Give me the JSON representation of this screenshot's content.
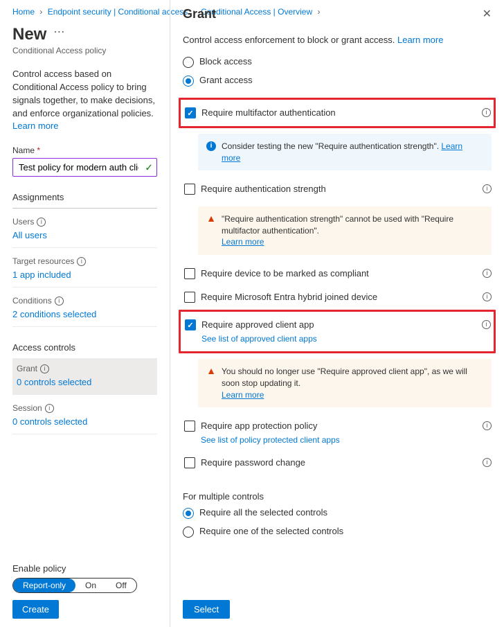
{
  "breadcrumb": [
    {
      "label": "Home"
    },
    {
      "label": "Endpoint security | Conditional access"
    },
    {
      "label": "Conditional Access | Overview"
    }
  ],
  "left": {
    "title": "New",
    "subtitle": "Conditional Access policy",
    "description": "Control access based on Conditional Access policy to bring signals together, to make decisions, and enforce organizational policies.",
    "learn_more": "Learn more",
    "name_label": "Name",
    "name_value": "Test policy for modern auth clients",
    "assignments_h": "Assignments",
    "users_label": "Users",
    "users_value": "All users",
    "target_label": "Target resources",
    "target_value": "1 app included",
    "conditions_label": "Conditions",
    "conditions_value": "2 conditions selected",
    "access_h": "Access controls",
    "grant_label": "Grant",
    "grant_value": "0 controls selected",
    "session_label": "Session",
    "session_value": "0 controls selected",
    "enable_label": "Enable policy",
    "toggle": {
      "report": "Report-only",
      "on": "On",
      "off": "Off"
    },
    "create": "Create"
  },
  "right": {
    "title": "Grant",
    "description_prefix": "Control access enforcement to block or grant access. ",
    "learn_more": "Learn more",
    "block_label": "Block access",
    "grant_label": "Grant access",
    "opts": {
      "mfa": "Require multifactor authentication",
      "info1_prefix": "Consider testing the new \"Require authentication strength\". ",
      "strength": "Require authentication strength",
      "warn1_prefix": "\"Require authentication strength\" cannot be used with \"Require multifactor authentication\".",
      "compliant": "Require device to be marked as compliant",
      "hybrid": "Require Microsoft Entra hybrid joined device",
      "approved": "Require approved client app",
      "approved_link": "See list of approved client apps",
      "warn2_prefix": "You should no longer use \"Require approved client app\", as we will soon stop updating it.",
      "protect": "Require app protection policy",
      "protect_link": "See list of policy protected client apps",
      "password": "Require password change"
    },
    "learn_more_short": "Learn more",
    "multi_label": "For multiple controls",
    "multi_all": "Require all the selected controls",
    "multi_one": "Require one of the selected controls",
    "select": "Select"
  }
}
